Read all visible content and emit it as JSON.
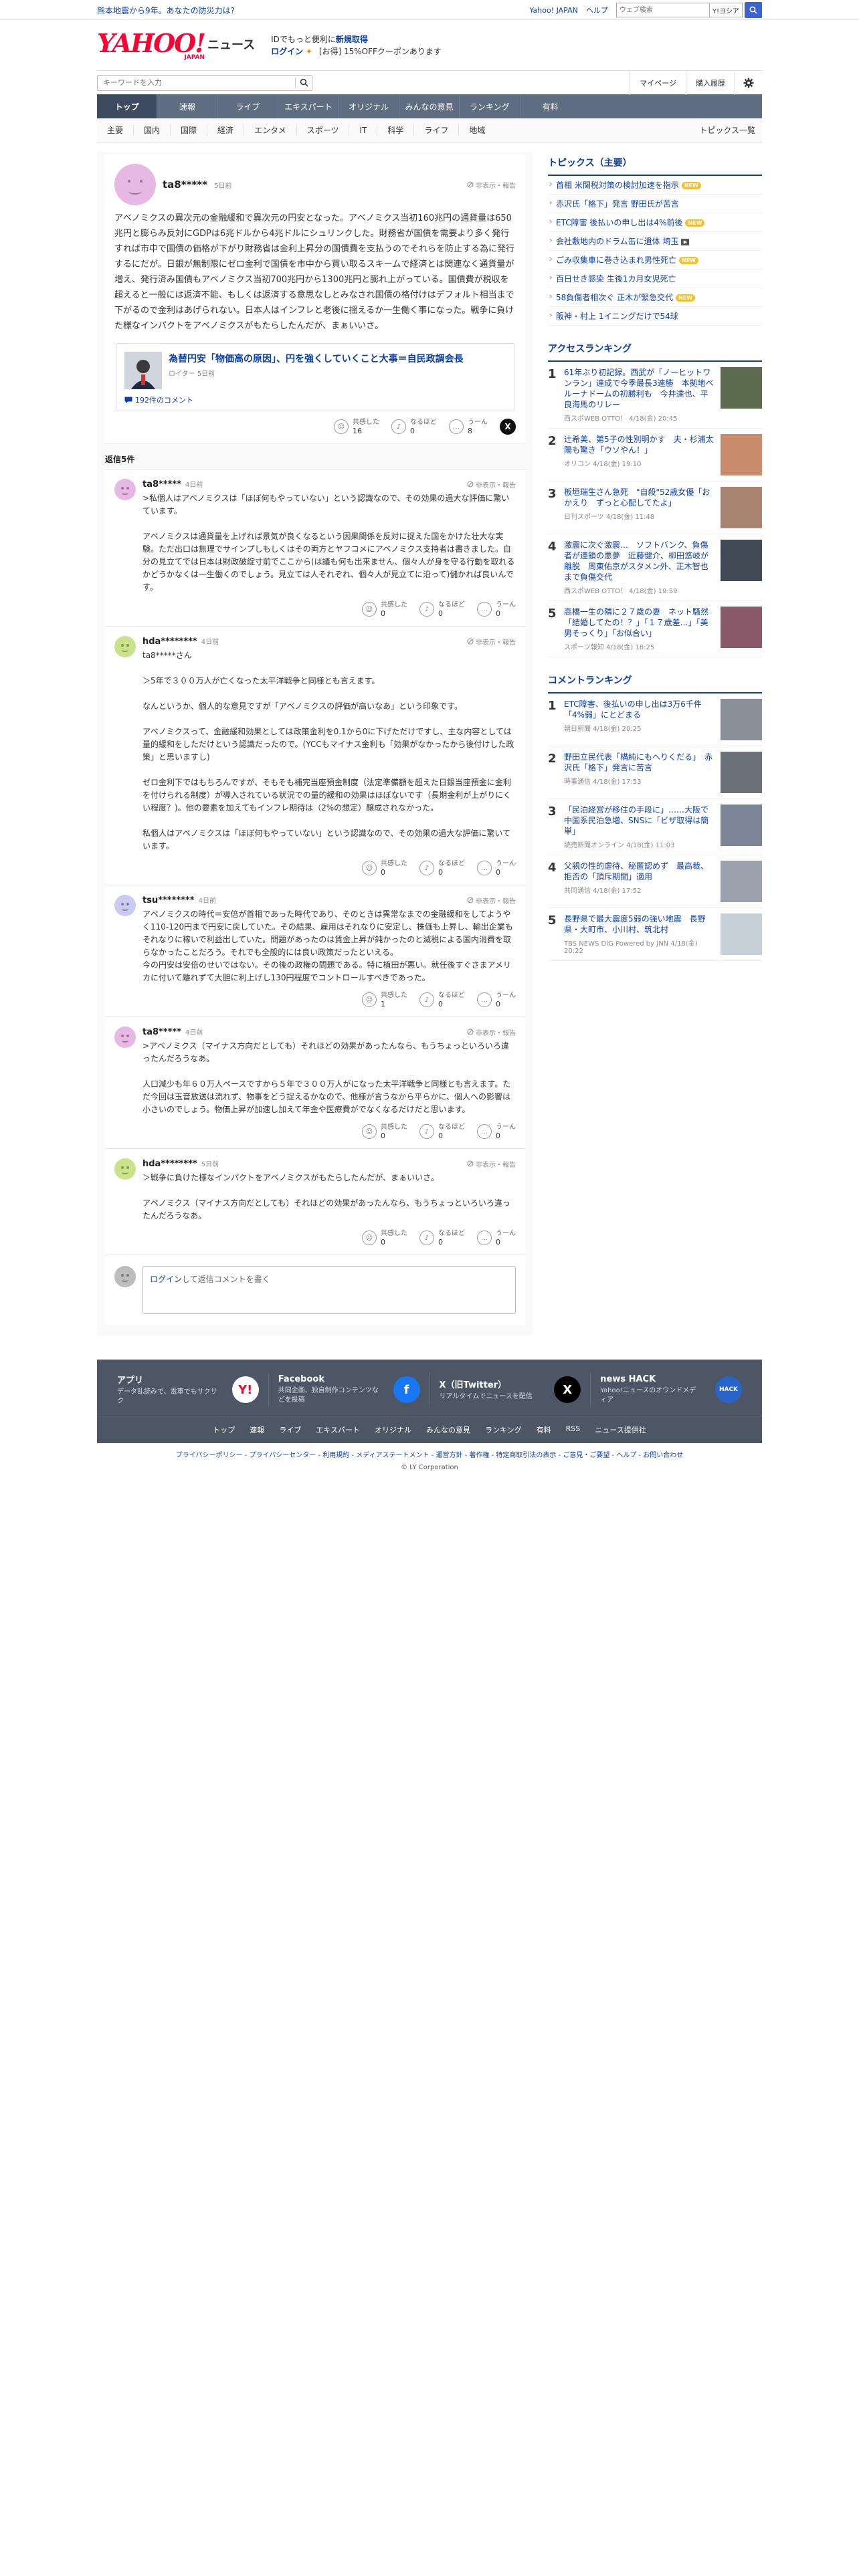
{
  "topbar": {
    "notice": "熊本地震から9年。あなたの防災力は?",
    "links": [
      "Yahoo! JAPAN",
      "ヘルプ"
    ],
    "search_placeholder": "ウェブ検索",
    "search_tag": "Y!ヨシア"
  },
  "header": {
    "logo_y": "YAHOO!",
    "logo_japan": "JAPAN",
    "logo_news": "ニュース",
    "promo_line1": "IDでもっと便利に",
    "promo_line1_b": "新規取得",
    "promo_login": "ログイン",
    "promo_coupon": "[お得] 15%OFFクーポンあります"
  },
  "searchrow": {
    "placeholder": "キーワードを入力",
    "links": [
      "マイページ",
      "購入履歴"
    ]
  },
  "mainnav": [
    "トップ",
    "速報",
    "ライブ",
    "エキスパート",
    "オリジナル",
    "みんなの意見",
    "ランキング",
    "有料"
  ],
  "subnav": {
    "items": [
      "主要",
      "国内",
      "国際",
      "経済",
      "エンタメ",
      "スポーツ",
      "IT",
      "科学",
      "ライフ",
      "地域"
    ],
    "topics": "トピックス一覧"
  },
  "original": {
    "user": "ta8*****",
    "time": "5日前",
    "hide": "非表示・報告",
    "text": "アベノミクスの異次元の金融緩和で異次元の円安となった。アベノミクス当初160兆円の通貨量は650兆円と膨らみ反対にGDPは6兆ドルから4兆ドルにシュリンクした。財務省が国債を需要より多く発行すれば市中で国債の価格が下がり財務省は金利上昇分の国債費を支払うのでそれらを防止する為に発行するにだが。日銀が無制限にゼロ金利で国債を市中から買い取るスキームで経済とは関連なく通貨量が増え、発行済み国債もアベノミクス当初700兆円から1300兆円と膨れ上がっている。国債費が税収を超えると一般には返済不能、もしくは返済する意思なしとみなされ国債の格付けはデフォルト相当まで下がるので金利はあげられない。日本人はインフレと老後に揺えるか一生働く事になった。戦争に負けた様なインパクトをアベノミクスがもたらしたんだが、まぁいいさ。",
    "article_title": "為替円安「物価高の原因」、円を強くしていくこと大事＝自民政調会長",
    "article_src": "ロイター 5日前",
    "article_comments": "192件のコメント",
    "reacts": [
      {
        "label": "共感した",
        "count": "16"
      },
      {
        "label": "なるほど",
        "count": "0"
      },
      {
        "label": "うーん",
        "count": "8"
      }
    ],
    "x_label": "X"
  },
  "reply_count": "返信5件",
  "replies": [
    {
      "user": "ta8*****",
      "time": "4日前",
      "hide": "非表示・報告",
      "text": ">私個人はアベノミクスは「ほぼ何もやっていない」という認識なので、その効果の過大な評価に驚いています。\n\nアベノミクスは通貨量を上げれば景気が良くなるという因果関係を反対に捉えた国をかけた壮大な実験。ただ出口は無理でサインプしもしくはその両方とヤフコメにアベノミクス支持者は書きました。自分の見立てでは日本は財政破綻寸前でここから(は議も何も出来ません、個々人が身を守る行動を取れるかどうかなくは一生働くのでしょう。見立ては人それぞれ、個々人が見立てに沿って)儲かれば良いんです。",
      "reacts": [
        {
          "label": "共感した",
          "count": "0"
        },
        {
          "label": "なるほど",
          "count": "0"
        },
        {
          "label": "うーん",
          "count": "0"
        }
      ]
    },
    {
      "user": "hda********",
      "time": "4日前",
      "hide": "非表示・報告",
      "text": "ta8*****さん\n\n＞5年で３００万人が亡くなった太平洋戦争と同様とも言えます。\n\nなんというか、個人的な意見ですが「アベノミクスの評価が高いなあ」という印象です。\n\nアベノミクスって、金融緩和効果としては政策金利を0.1から0に下げただけですし、主な内容としては量的緩和をしただけという認識だったので。(YCCもマイナス金利も「効果がなかったから後付けした政策」と思いますし)\n\nゼロ金利下ではもちろんですが、そもそも補完当座預金制度（法定準備額を超えた日銀当座預金に金利を付けられる制度）が導入されている状況での量的緩和の効果はほぼないです（長期金利が上がりにくい程度？)。他の要素を加えてもインフレ期待は（2%の想定）醸成されなかった。\n\n私個人はアベノミクスは「ほぼ何もやっていない」という認識なので、その効果の過大な評価に驚いています。",
      "reacts": [
        {
          "label": "共感した",
          "count": "0"
        },
        {
          "label": "なるほど",
          "count": "0"
        },
        {
          "label": "うーん",
          "count": "0"
        }
      ]
    },
    {
      "user": "tsu********",
      "time": "4日前",
      "hide": "非表示・報告",
      "text": "アベノミクスの時代＝安倍が首相であった時代であり、そのときは異常なまでの金融緩和をしてようやく110-120円まで円安に戻していた。その結果、雇用はそれなりに安定し、株価も上昇し、輸出企業もそれなりに稼いで利益出していた。問題があったのは賃金上昇が鈍かったのと減税による国内消費を取らなかったことだろう。それでも全般的には良い政策だったといえる。\n今の円安は安倍のせいではない。その後の政権の問題である。特に植田が悪い。就任後すぐさまアメリカに付いて離れずて大胆に利上げし130円程度でコントロールすべきであった。",
      "reacts": [
        {
          "label": "共感した",
          "count": "1"
        },
        {
          "label": "なるほど",
          "count": "0"
        },
        {
          "label": "うーん",
          "count": "0"
        }
      ]
    },
    {
      "user": "ta8*****",
      "time": "4日前",
      "hide": "非表示・報告",
      "text": ">アベノミクス（マイナス方向だとしても）それほどの効果があったんなら、もうちょっといろいろ違ったんだろうなあ。\n\n人口減少も年６０万人ペースですから５年で３００万人がになった太平洋戦争と同様とも言えます。ただ今回は玉音放送は流れず、物事をどう捉えるかなので、他様が言うなから平らかに、個人への影響は小さいのでしょう。物価上昇が加速し加えて年金や医療費がでなくなるだけだと思います。",
      "reacts": [
        {
          "label": "共感した",
          "count": "0"
        },
        {
          "label": "なるほど",
          "count": "0"
        },
        {
          "label": "うーん",
          "count": "0"
        }
      ]
    },
    {
      "user": "hda********",
      "time": "5日前",
      "hide": "非表示・報告",
      "text": "＞戦争に負けた様なインパクトをアベノミクスがもたらしたんだが、まぁいいさ。\n\nアベノミクス（マイナス方向だとしても）それほどの効果があったんなら、もうちょっといろいろ違ったんだろうなあ。",
      "reacts": [
        {
          "label": "共感した",
          "count": "0"
        },
        {
          "label": "なるほど",
          "count": "0"
        },
        {
          "label": "うーん",
          "count": "0"
        }
      ]
    }
  ],
  "reply_form": {
    "login": "ログイン",
    "rest": "して返信コメントを書く"
  },
  "sidebar": {
    "topics_title": "トピックス（主要）",
    "topics": [
      {
        "text": "首相 米関税対策の検討加速を指示",
        "badge": "new"
      },
      {
        "text": "赤沢氏「格下」発言 野田氏が苦言",
        "badge": ""
      },
      {
        "text": "ETC障害 後払いの申し出は4%前後",
        "badge": "new"
      },
      {
        "text": "会社敷地内のドラム缶に遺体 埼玉",
        "badge": "video"
      },
      {
        "text": "ごみ収集車に巻き込まれ男性死亡",
        "badge": "new"
      },
      {
        "text": "百日せき感染 生後1カ月女児死亡",
        "badge": ""
      },
      {
        "text": "58負傷者相次ぐ 正木が緊急交代",
        "badge": "new"
      },
      {
        "text": "阪神・村上 1イニングだけで54球",
        "badge": ""
      }
    ],
    "access_title": "アクセスランキング",
    "access": [
      {
        "no": "1",
        "title": "61年ぶり初記録。西武が「ノーヒットワンラン」達成で今季最長3連勝　本拠地ベルーナドームの初勝利も　今井達也、平良海馬のリレー",
        "meta": "西スポWEB OTTO！ 4/18(金) 20:45",
        "img": "#5a6b4e"
      },
      {
        "no": "2",
        "title": "辻希美、第5子の性別明かす　夫・杉浦太陽も驚き「ウソやん！」",
        "meta": "オリコン 4/18(金) 19:10",
        "img": "#c98b6c"
      },
      {
        "no": "3",
        "title": "板垣瑞生さん急死　\"自殺\"52歳女優「おかえり　ずっと心配してたよ」",
        "meta": "日刊スポーツ 4/18(金) 11:48",
        "img": "#a98472"
      },
      {
        "no": "4",
        "title": "激震に次ぐ激震…　ソフトバンク、負傷者が連鎖の悪夢　近藤健介、柳田悠岐が離脱　周東佑京がスタメン外、正木智也まで負傷交代",
        "meta": "西スポWEB OTTO！ 4/18(金) 19:59",
        "img": "#3f4a55"
      },
      {
        "no": "5",
        "title": "高橋一生の隣に２７歳の妻　ネット騒然「結婚してたの！？」「１７歳差…」「美男そっくり」「お似合い」",
        "meta": "スポーツ報知 4/18(金) 18:25",
        "img": "#8a5a6a"
      }
    ],
    "comment_title": "コメントランキング",
    "comments": [
      {
        "no": "1",
        "title": "ETC障害、後払いの申し出は3万6千件「4%弱」にとどまる",
        "meta": "朝日新聞 4/18(金) 20:25",
        "img": "#8a9099"
      },
      {
        "no": "2",
        "title": "野田立民代表「構純にもへりくだる」　赤沢氏「格下」発言に苦言",
        "meta": "時事通信 4/18(金) 17:53",
        "img": "#6a6f78"
      },
      {
        "no": "3",
        "title": "「民泊経営が移住の手段に」……大阪で中国系民泊急増、SNSに「ビザ取得は簡単」",
        "meta": "読売新聞オンライン 4/18(金) 11:03",
        "img": "#7c8696"
      },
      {
        "no": "4",
        "title": "父親の性的虐待、秘匿認めず　最高裁、拒否の「頂斥期間」適用",
        "meta": "共同通信 4/18(金) 17:52",
        "img": "#9aa3ad"
      },
      {
        "no": "5",
        "title": "長野県で最大震度5弱の強い地震　長野県・大町市、小川村、筑北村",
        "meta": "TBS NEWS DIG Powered by JNN 4/18(金) 20:22",
        "img": "#c5d0d8"
      }
    ]
  },
  "footer": {
    "apps": [
      {
        "title": "アプリ",
        "desc": "データ乱読みで、電車でもサクサク",
        "icon": "Y!",
        "icon_bg": "#ffffff",
        "icon_fg": "#ff0033"
      },
      {
        "title": "Facebook",
        "desc": "共同企画、独自制作コンテンツなどを投稿",
        "icon": "f",
        "icon_bg": "#1877f2",
        "icon_fg": "#ffffff"
      },
      {
        "title": "X（旧Twitter）",
        "desc": "リアルタイムでニュースを配信",
        "icon": "X",
        "icon_bg": "#000000",
        "icon_fg": "#ffffff"
      },
      {
        "title": "news HACK",
        "desc": "Yahoo!ニュースのオウンドメディア",
        "icon": "HACK",
        "icon_bg": "#2a64c8",
        "icon_fg": "#ffffff"
      }
    ],
    "nav": [
      "トップ",
      "速報",
      "ライブ",
      "エキスパート",
      "オリジナル",
      "みんなの意見",
      "ランキング",
      "有料",
      "RSS",
      "ニュース提供社"
    ]
  },
  "legal": {
    "links": "プライバシーポリシー - プライバシーセンター - 利用規約 - メディアステートメント - 運営方針 - 著作権 - 特定商取引法の表示 - ご意見・ご要望 - ヘルプ - お問い合わせ",
    "copy": "© LY Corporation"
  }
}
